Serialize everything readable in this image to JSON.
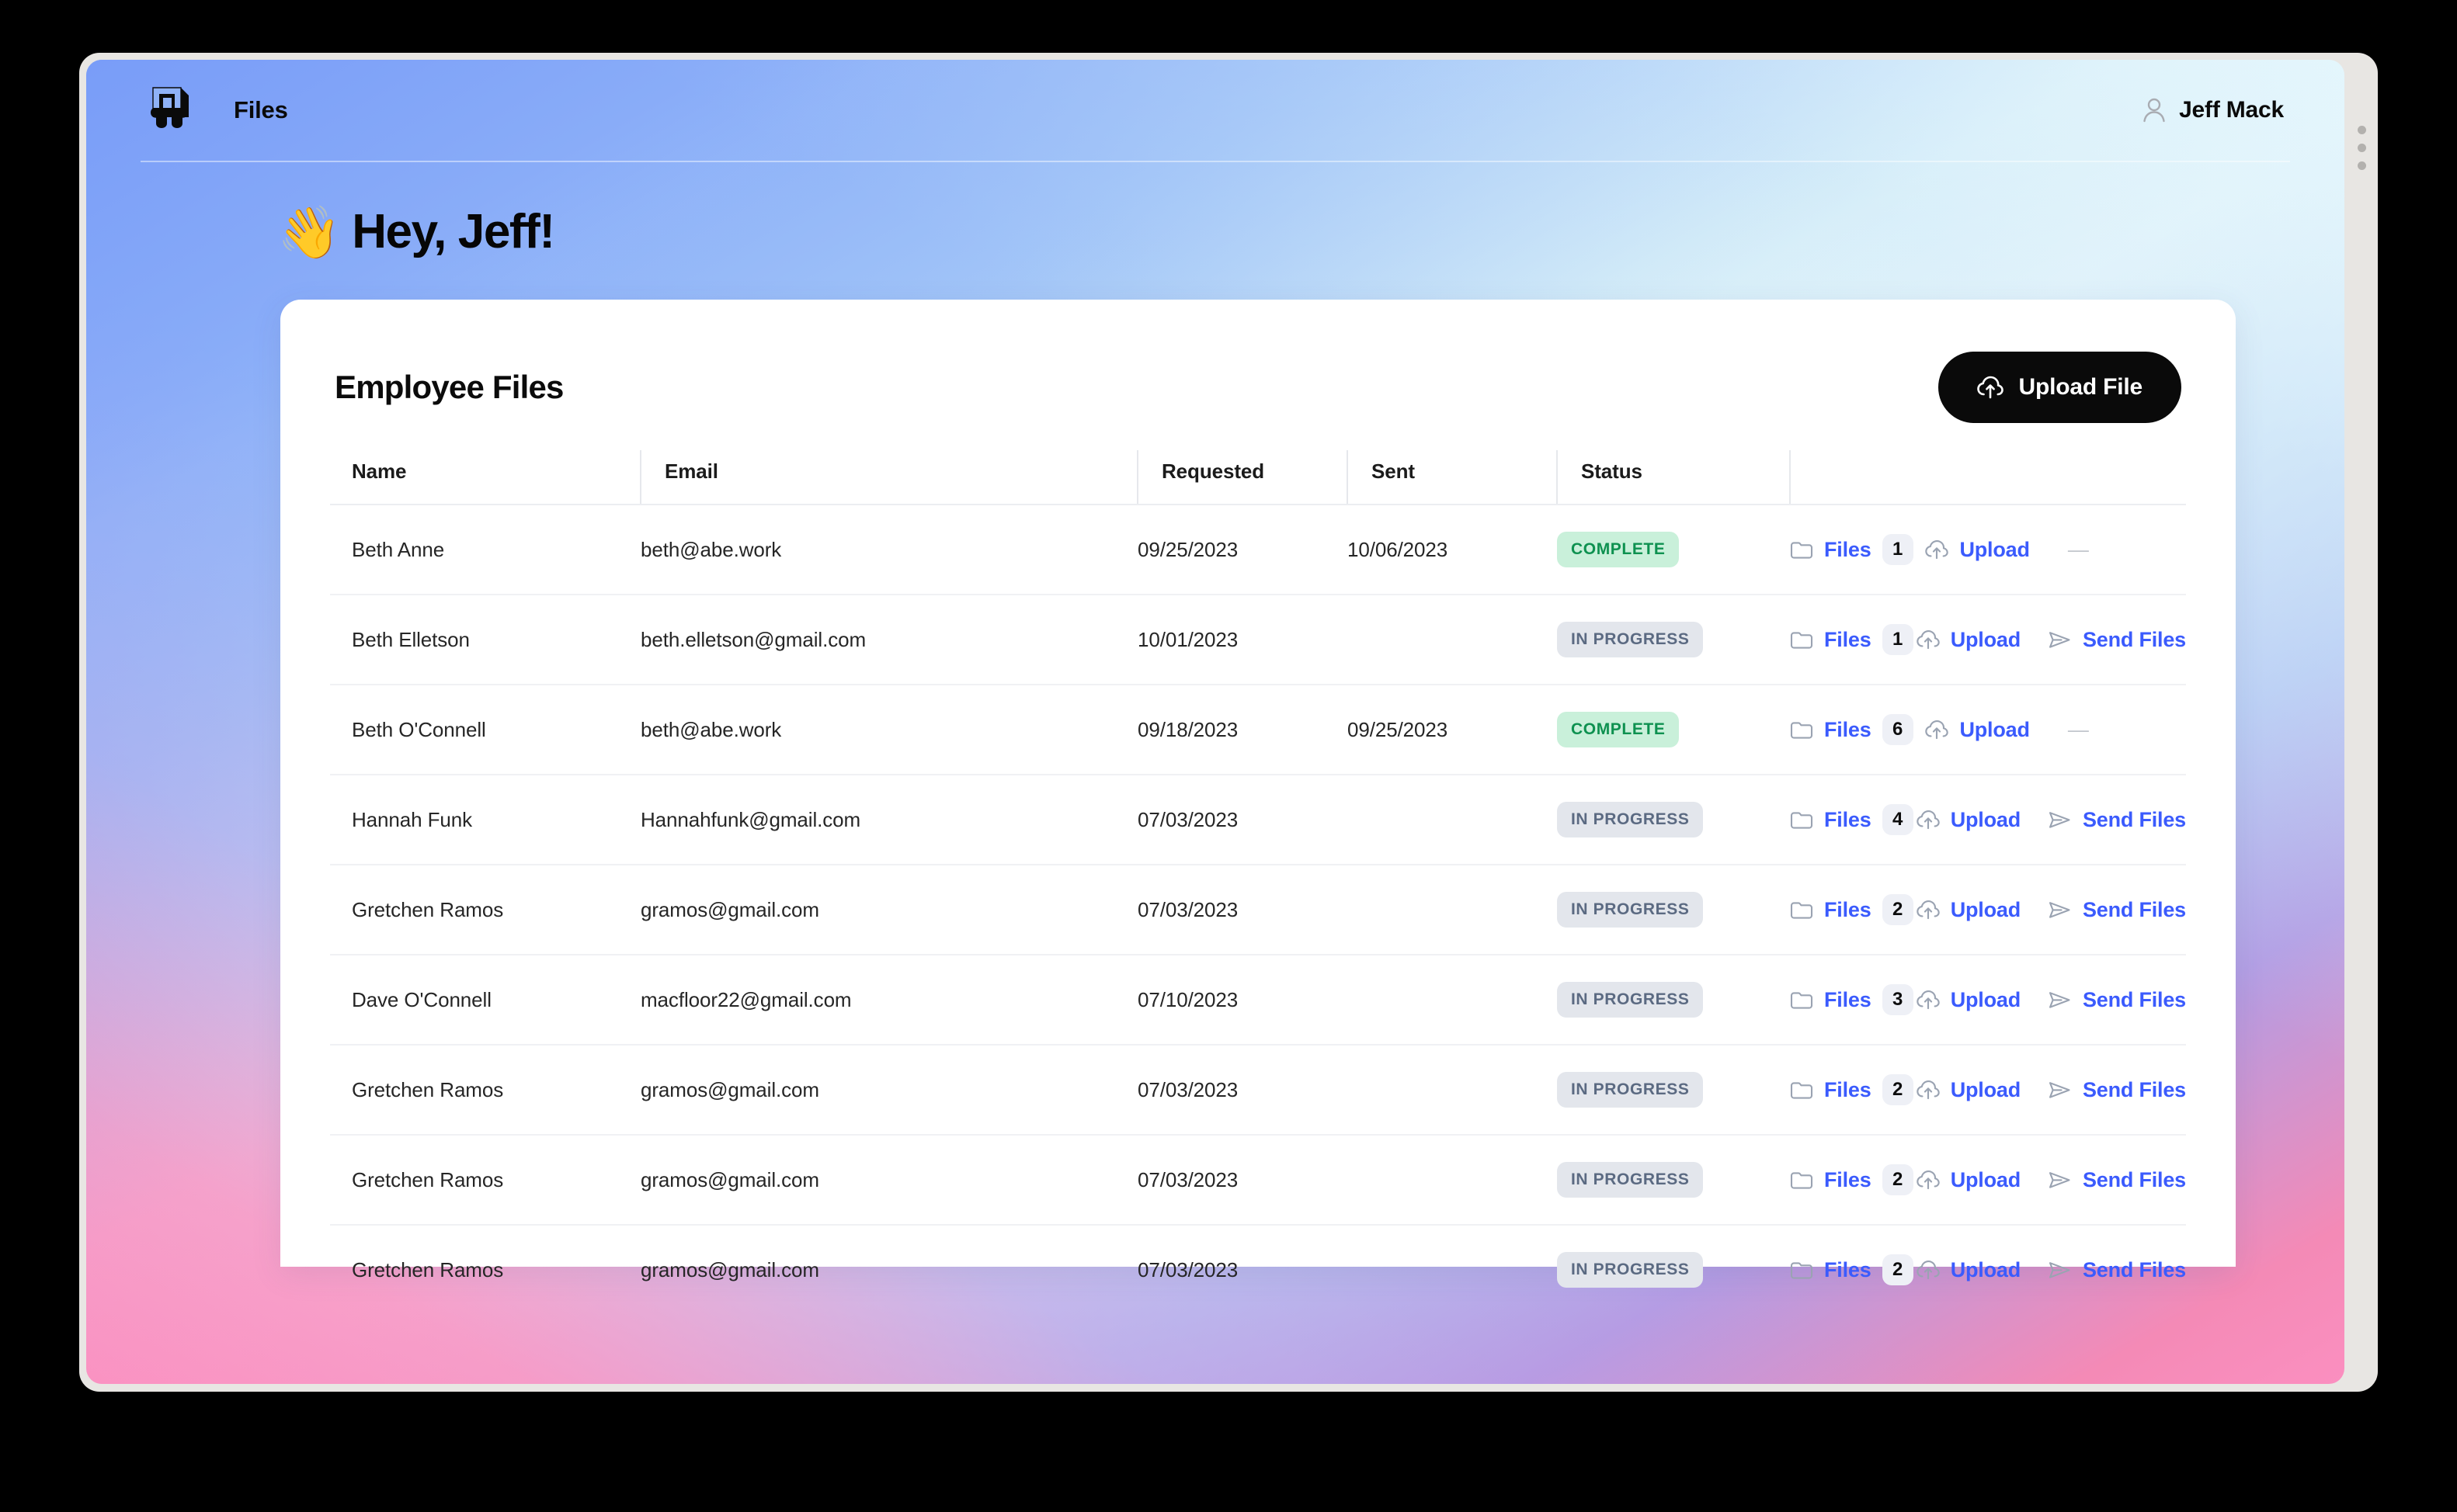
{
  "header": {
    "app_title": "Files",
    "logo_name": "abstract-a-logo",
    "user": {
      "name": "Jeff Mack",
      "icon": "person-icon"
    }
  },
  "greeting": {
    "emoji": "👋",
    "text": "Hey, Jeff!"
  },
  "card": {
    "title": "Employee Files",
    "upload_button": {
      "label": "Upload File",
      "icon": "cloud-upload-icon"
    }
  },
  "table": {
    "columns": [
      "Name",
      "Email",
      "Requested",
      "Sent",
      "Status",
      ""
    ],
    "action_labels": {
      "files": "Files",
      "upload": "Upload",
      "send": "Send Files",
      "empty": "—"
    },
    "action_icons": {
      "files": "folder-icon",
      "upload": "cloud-upload-icon",
      "send": "paper-plane-icon"
    },
    "rows": [
      {
        "name": "Beth Anne",
        "email": "beth@abe.work",
        "requested": "09/25/2023",
        "sent": "10/06/2023",
        "status": "COMPLETE",
        "status_kind": "complete",
        "file_count": "1",
        "has_send": false
      },
      {
        "name": "Beth Elletson",
        "email": "beth.elletson@gmail.com",
        "requested": "10/01/2023",
        "sent": "",
        "status": "IN PROGRESS",
        "status_kind": "in-progress",
        "file_count": "1",
        "has_send": true
      },
      {
        "name": "Beth O'Connell",
        "email": "beth@abe.work",
        "requested": "09/18/2023",
        "sent": "09/25/2023",
        "status": "COMPLETE",
        "status_kind": "complete",
        "file_count": "6",
        "has_send": false
      },
      {
        "name": "Hannah Funk",
        "email": "Hannahfunk@gmail.com",
        "requested": "07/03/2023",
        "sent": "",
        "status": "IN PROGRESS",
        "status_kind": "in-progress",
        "file_count": "4",
        "has_send": true
      },
      {
        "name": "Gretchen Ramos",
        "email": "gramos@gmail.com",
        "requested": "07/03/2023",
        "sent": "",
        "status": "IN PROGRESS",
        "status_kind": "in-progress",
        "file_count": "2",
        "has_send": true
      },
      {
        "name": "Dave O'Connell",
        "email": "macfloor22@gmail.com",
        "requested": "07/10/2023",
        "sent": "",
        "status": "IN PROGRESS",
        "status_kind": "in-progress",
        "file_count": "3",
        "has_send": true
      },
      {
        "name": "Gretchen Ramos",
        "email": "gramos@gmail.com",
        "requested": "07/03/2023",
        "sent": "",
        "status": "IN PROGRESS",
        "status_kind": "in-progress",
        "file_count": "2",
        "has_send": true
      },
      {
        "name": "Gretchen Ramos",
        "email": "gramos@gmail.com",
        "requested": "07/03/2023",
        "sent": "",
        "status": "IN PROGRESS",
        "status_kind": "in-progress",
        "file_count": "2",
        "has_send": true
      },
      {
        "name": "Gretchen Ramos",
        "email": "gramos@gmail.com",
        "requested": "07/03/2023",
        "sent": "",
        "status": "IN PROGRESS",
        "status_kind": "in-progress",
        "file_count": "2",
        "has_send": true
      }
    ]
  },
  "colors": {
    "accent_link": "#3b5bfd",
    "status_complete_bg": "#c9f0da",
    "status_complete_text": "#0e9150",
    "status_progress_bg": "#e3e6ec",
    "status_progress_text": "#5b6a82",
    "button_bg": "#0a0a0a",
    "gradient_blue": "#8aa9f5",
    "gradient_cyan": "#eaf6fb",
    "gradient_pink": "#fb8fc0"
  }
}
